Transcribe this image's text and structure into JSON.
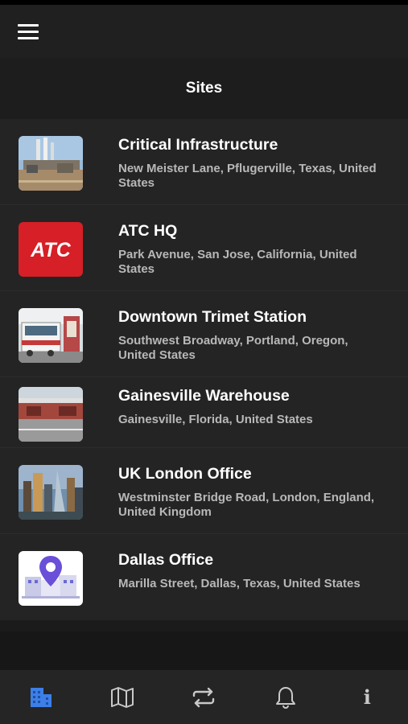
{
  "header": {
    "title": "Sites",
    "menu_icon": "hamburger-menu-icon"
  },
  "sites": [
    {
      "name": "Critical Infrastructure",
      "address": "New Meister Lane, Pflugerville, Texas, United States",
      "thumb": "industrial-plant"
    },
    {
      "name": "ATC HQ",
      "address": "Park Avenue, San Jose, California, United States",
      "thumb": "atc-logo",
      "logo_text": "ATC",
      "logo_color": "#d61f26"
    },
    {
      "name": "Downtown Trimet Station",
      "address": "Southwest Broadway, Portland, Oregon, United States",
      "thumb": "train-station"
    },
    {
      "name": "Gainesville Warehouse",
      "address": "Gainesville, Florida, United States",
      "thumb": "warehouse"
    },
    {
      "name": "UK London Office",
      "address": "Westminster Bridge Road, London, England, United Kingdom",
      "thumb": "city-skyline"
    },
    {
      "name": "Dallas Office",
      "address": "Marilla Street, Dallas, Texas, United States",
      "thumb": "map-pin-building"
    }
  ],
  "bottom_nav": [
    {
      "id": "sites",
      "icon": "building-icon",
      "active": true,
      "color": "#3d7fe8"
    },
    {
      "id": "map",
      "icon": "map-icon",
      "active": false
    },
    {
      "id": "transfer",
      "icon": "repeat-arrows-icon",
      "active": false
    },
    {
      "id": "notifications",
      "icon": "bell-icon",
      "active": false
    },
    {
      "id": "info",
      "icon": "info-icon",
      "active": false,
      "glyph": "i"
    }
  ],
  "colors": {
    "background": "#1b1b1b",
    "list_bg": "#242424",
    "nav_bg": "#252525",
    "active": "#3d7fe8",
    "inactive_icon": "#c9c9c9",
    "address_text": "#b8b8b8"
  }
}
